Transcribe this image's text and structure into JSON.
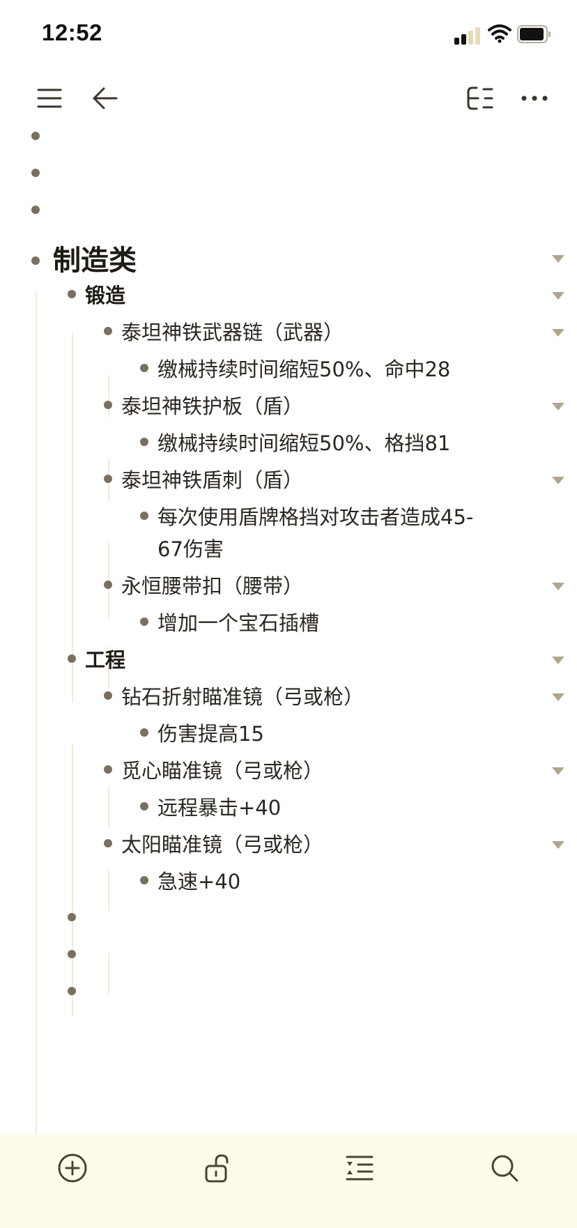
{
  "status_bar": {
    "time": "12:52",
    "icons": [
      "cellular-signal-icon",
      "wifi-icon",
      "battery-icon"
    ]
  },
  "toolbar": {
    "left_icons": [
      "menu-icon",
      "back-arrow-icon"
    ],
    "right_icons": [
      "outline-structure-icon",
      "more-icon"
    ]
  },
  "outline": {
    "items": [
      {
        "level": 0,
        "text": ""
      },
      {
        "level": 0,
        "text": ""
      },
      {
        "level": 0,
        "text": ""
      },
      {
        "level": 0,
        "text": "制造类",
        "style": "heading1",
        "collapsible": true
      },
      {
        "level": 1,
        "text": "锻造",
        "style": "heading2",
        "collapsible": true
      },
      {
        "level": 2,
        "text": "泰坦神铁武器链（武器）",
        "collapsible": true
      },
      {
        "level": 3,
        "text": "缴械持续时间缩短50%、命中28"
      },
      {
        "level": 2,
        "text": "泰坦神铁护板（盾）",
        "collapsible": true
      },
      {
        "level": 3,
        "text": "缴械持续时间缩短50%、格挡81"
      },
      {
        "level": 2,
        "text": "泰坦神铁盾刺（盾）",
        "collapsible": true
      },
      {
        "level": 3,
        "text": "每次使用盾牌格挡对攻击者造成45-",
        "continuation": "67伤害"
      },
      {
        "level": 2,
        "text": "永恒腰带扣（腰带）",
        "collapsible": true
      },
      {
        "level": 3,
        "text": "增加一个宝石插槽"
      },
      {
        "level": 1,
        "text": "工程",
        "style": "heading2",
        "collapsible": true
      },
      {
        "level": 2,
        "text": "钻石折射瞄准镜（弓或枪）",
        "collapsible": true
      },
      {
        "level": 3,
        "text": "伤害提高15"
      },
      {
        "level": 2,
        "text": "觅心瞄准镜（弓或枪）",
        "collapsible": true
      },
      {
        "level": 3,
        "text": "远程暴击+40"
      },
      {
        "level": 2,
        "text": "太阳瞄准镜（弓或枪）",
        "collapsible": true
      },
      {
        "level": 3,
        "text": "急速+40"
      },
      {
        "level": 1,
        "text": ""
      },
      {
        "level": 1,
        "text": ""
      },
      {
        "level": 1,
        "text": ""
      }
    ]
  },
  "bottom_bar": {
    "icons": [
      "add-circle-icon",
      "unlock-icon",
      "indent-outdent-icon",
      "search-icon"
    ]
  },
  "colors": {
    "bullet": "#7a7060",
    "caret": "#b0a68f",
    "guide": "#f3ecd5",
    "bottom_bar_bg": "#fdfbea",
    "text": "#2b2620"
  }
}
